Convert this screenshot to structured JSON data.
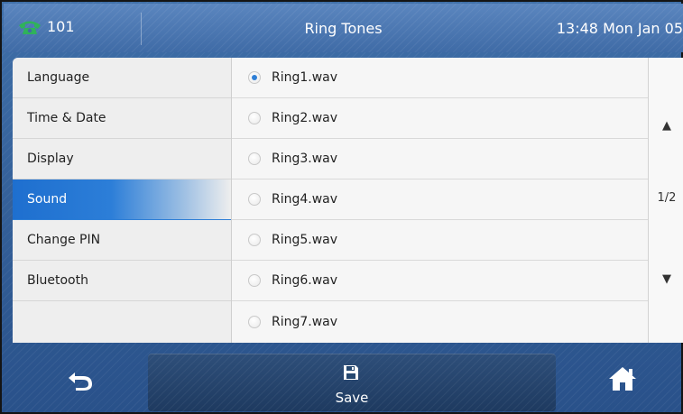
{
  "header": {
    "line_label": "101",
    "title": "Ring Tones",
    "datetime": "13:48 Mon Jan 05"
  },
  "sidebar": {
    "items": [
      {
        "label": "Language"
      },
      {
        "label": "Time & Date"
      },
      {
        "label": "Display"
      },
      {
        "label": "Sound"
      },
      {
        "label": "Change PIN"
      },
      {
        "label": "Bluetooth"
      }
    ],
    "active_index": 3
  },
  "ringtones": {
    "items": [
      {
        "label": "Ring1.wav",
        "selected": true
      },
      {
        "label": "Ring2.wav",
        "selected": false
      },
      {
        "label": "Ring3.wav",
        "selected": false
      },
      {
        "label": "Ring4.wav",
        "selected": false
      },
      {
        "label": "Ring5.wav",
        "selected": false
      },
      {
        "label": "Ring6.wav",
        "selected": false
      },
      {
        "label": "Ring7.wav",
        "selected": false
      }
    ]
  },
  "scroll": {
    "up_symbol": "▲",
    "page_indicator": "1/2",
    "down_symbol": "▼"
  },
  "footer": {
    "save_label": "Save",
    "back_icon": "back-arrow-icon",
    "save_icon": "floppy-disk-icon",
    "home_icon": "home-icon"
  },
  "colors": {
    "accent": "#2f7fd6",
    "header_bg": "#4a78b5",
    "footer_bg": "#2a5289",
    "save_button_bg": "#264870",
    "phone_icon": "#2fb25a"
  }
}
